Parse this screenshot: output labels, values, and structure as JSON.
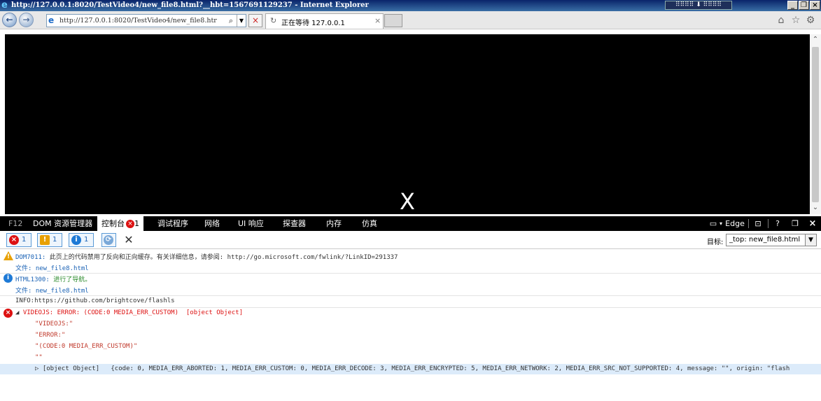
{
  "window": {
    "title": "http://127.0.0.1:8020/TestVideo4/new_file8.html?__hbt=1567691129237 - Internet Explorer",
    "minimize": "_",
    "restore": "❐",
    "close": "×"
  },
  "nav": {
    "back_icon": "back-arrow-icon",
    "forward_icon": "forward-arrow-icon",
    "address": "http://127.0.0.1:8020/TestVideo4/new_file8.htr",
    "tab_label": "正在等待 127.0.0.1",
    "tab_close": "×",
    "stop": "×"
  },
  "video": {
    "close_mark": "X"
  },
  "devtools": {
    "tabs": {
      "f12": "F12",
      "dom": "DOM 资源管理器",
      "console": "控制台",
      "console_errors": "1",
      "debugger": "调试程序",
      "network": "网络",
      "ui": "UI 响应",
      "profiler": "探查器",
      "memory": "内存",
      "emulation": "仿真"
    },
    "right": {
      "edge": "Edge",
      "help": "?",
      "close": "×"
    },
    "toolbar": {
      "errors_count": "1",
      "warnings_count": "1",
      "info_count": "1",
      "target_label": "目标:",
      "target_value": "_top: new_file8.html"
    }
  },
  "console": {
    "warn": {
      "code": "DOM7011:",
      "message": " 此页上的代码禁用了反向和正向缓存。有关详细信息，请参阅: http://go.microsoft.com/fwlink/?LinkID=291337",
      "file": "文件: new_file8.html"
    },
    "info": {
      "code": "HTML1300:",
      "message": " 进行了导航。",
      "file": "文件: new_file8.html"
    },
    "log": "INFO:https://github.com/brightcove/flashls",
    "error": {
      "header": "VIDEOJS: ERROR: (CODE:0 MEDIA_ERR_CUSTOM)",
      "object_text": "[object Object]",
      "lines": [
        "\"VIDEOJS:\"",
        "\"ERROR:\"",
        "\"(CODE:0 MEDIA_ERR_CUSTOM)\"",
        "\"\""
      ],
      "obj_label": "[object Object]",
      "obj_detail": "{code: 0, MEDIA_ERR_ABORTED: 1, MEDIA_ERR_CUSTOM: 0, MEDIA_ERR_DECODE: 3, MEDIA_ERR_ENCRYPTED: 5, MEDIA_ERR_NETWORK: 2, MEDIA_ERR_SRC_NOT_SUPPORTED: 4, message: \"\", origin: \"flash"
    }
  },
  "colors": {
    "title_bar": "#0a246a",
    "devtabs_bg": "#000000",
    "error_red": "#dd1111",
    "link_blue": "#1a62b5",
    "selected_row": "#dcebfa"
  }
}
